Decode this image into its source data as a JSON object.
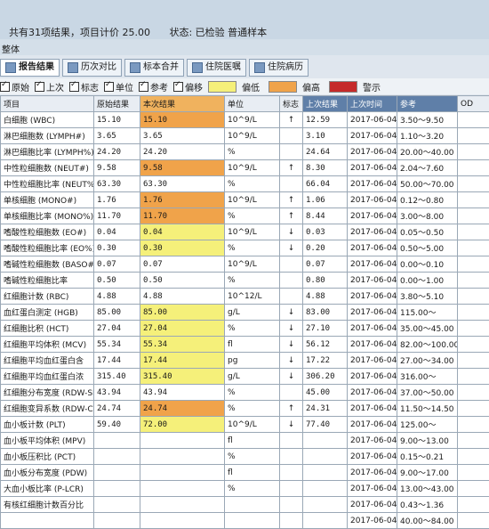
{
  "header": {
    "summary_count": "共有31项结果，项目计价 25.00",
    "summary_status": "状态: 已检验 普通样本",
    "group_label": "整体"
  },
  "tabs": [
    "报告结果",
    "历次对比",
    "标本合并",
    "住院医嘱",
    "住院病历"
  ],
  "filters": {
    "items": [
      "原始",
      "上次",
      "标志",
      "单位",
      "参考",
      "偏移"
    ],
    "legend": [
      {
        "label": "偏低",
        "color": "#f5f07a"
      },
      {
        "label": "偏高",
        "color": "#f0a34a"
      },
      {
        "label": "警示",
        "color": "#c52a2a"
      }
    ]
  },
  "columns": [
    "项目",
    "原始结果",
    "本次结果",
    "单位",
    "标志",
    "上次结果",
    "上次时间",
    "参考",
    "OD"
  ],
  "rows": [
    {
      "name": "白细胞 (WBC)",
      "orig": "15.10",
      "cur": "15.10",
      "unit": "10^9/L",
      "flag": "↑",
      "prev": "12.59",
      "date": "2017-06-04",
      "ref": "3.50～9.50",
      "hl": "o"
    },
    {
      "name": "淋巴细胞数 (LYMPH#)",
      "orig": "3.65",
      "cur": "3.65",
      "unit": "10^9/L",
      "flag": "",
      "prev": "3.10",
      "date": "2017-06-04",
      "ref": "1.10～3.20",
      "hl": ""
    },
    {
      "name": "淋巴细胞比率 (LYMPH%)",
      "orig": "24.20",
      "cur": "24.20",
      "unit": "%",
      "flag": "",
      "prev": "24.64",
      "date": "2017-06-04",
      "ref": "20.00～40.00",
      "hl": ""
    },
    {
      "name": "中性粒细胞数 (NEUT#)",
      "orig": "9.58",
      "cur": "9.58",
      "unit": "10^9/L",
      "flag": "↑",
      "prev": "8.30",
      "date": "2017-06-04",
      "ref": "2.04～7.60",
      "hl": "o"
    },
    {
      "name": "中性粒细胞比率 (NEUT%)",
      "orig": "63.30",
      "cur": "63.30",
      "unit": "%",
      "flag": "",
      "prev": "66.04",
      "date": "2017-06-04",
      "ref": "50.00～70.00",
      "hl": ""
    },
    {
      "name": "单核细胞 (MONO#)",
      "orig": "1.76",
      "cur": "1.76",
      "unit": "10^9/L",
      "flag": "↑",
      "prev": "1.06",
      "date": "2017-06-04",
      "ref": "0.12～0.80",
      "hl": "o"
    },
    {
      "name": "单核细胞比率 (MONO%)",
      "orig": "11.70",
      "cur": "11.70",
      "unit": "%",
      "flag": "↑",
      "prev": "8.44",
      "date": "2017-06-04",
      "ref": "3.00～8.00",
      "hl": "o"
    },
    {
      "name": "嗜酸性粒细胞数 (EO#)",
      "orig": "0.04",
      "cur": "0.04",
      "unit": "10^9/L",
      "flag": "↓",
      "prev": "0.03",
      "date": "2017-06-04",
      "ref": "0.05～0.50",
      "hl": "y"
    },
    {
      "name": "嗜酸性粒细胞比率 (EO%)",
      "orig": "0.30",
      "cur": "0.30",
      "unit": "%",
      "flag": "↓",
      "prev": "0.20",
      "date": "2017-06-04",
      "ref": "0.50～5.00",
      "hl": "y"
    },
    {
      "name": "嗜碱性粒细胞数 (BASO#)",
      "orig": "0.07",
      "cur": "0.07",
      "unit": "10^9/L",
      "flag": "",
      "prev": "0.07",
      "date": "2017-06-04",
      "ref": "0.00～0.10",
      "hl": ""
    },
    {
      "name": "嗜碱性粒细胞比率",
      "orig": "0.50",
      "cur": "0.50",
      "unit": "%",
      "flag": "",
      "prev": "0.80",
      "date": "2017-06-04",
      "ref": "0.00～1.00",
      "hl": ""
    },
    {
      "name": "红细胞计数 (RBC)",
      "orig": "4.88",
      "cur": "4.88",
      "unit": "10^12/L",
      "flag": "",
      "prev": "4.88",
      "date": "2017-06-04",
      "ref": "3.80～5.10",
      "hl": ""
    },
    {
      "name": "血红蛋白测定 (HGB)",
      "orig": "85.00",
      "cur": "85.00",
      "unit": "g/L",
      "flag": "↓",
      "prev": "83.00",
      "date": "2017-06-04",
      "ref": "115.00～",
      "hl": "y"
    },
    {
      "name": "红细胞比积 (HCT)",
      "orig": "27.04",
      "cur": "27.04",
      "unit": "%",
      "flag": "↓",
      "prev": "27.10",
      "date": "2017-06-04",
      "ref": "35.00～45.00",
      "hl": "y"
    },
    {
      "name": "红细胞平均体积 (MCV)",
      "orig": "55.34",
      "cur": "55.34",
      "unit": "fl",
      "flag": "↓",
      "prev": "56.12",
      "date": "2017-06-04",
      "ref": "82.00～100.00",
      "hl": "y"
    },
    {
      "name": "红细胞平均血红蛋白含",
      "orig": "17.44",
      "cur": "17.44",
      "unit": "pg",
      "flag": "↓",
      "prev": "17.22",
      "date": "2017-06-04",
      "ref": "27.00～34.00",
      "hl": "y"
    },
    {
      "name": "红细胞平均血红蛋白浓",
      "orig": "315.40",
      "cur": "315.40",
      "unit": "g/L",
      "flag": "↓",
      "prev": "306.20",
      "date": "2017-06-04",
      "ref": "316.00～",
      "hl": "y"
    },
    {
      "name": "红细胞分布宽度 (RDW-SD)",
      "orig": "43.94",
      "cur": "43.94",
      "unit": "%",
      "flag": "",
      "prev": "45.00",
      "date": "2017-06-04",
      "ref": "37.00～50.00",
      "hl": ""
    },
    {
      "name": "红细胞变异系数 (RDW-CV)",
      "orig": "24.74",
      "cur": "24.74",
      "unit": "%",
      "flag": "↑",
      "prev": "24.31",
      "date": "2017-06-04",
      "ref": "11.50～14.50",
      "hl": "o"
    },
    {
      "name": "血小板计数 (PLT)",
      "orig": "59.40",
      "cur": "72.00",
      "unit": "10^9/L",
      "flag": "↓",
      "prev": "77.40",
      "date": "2017-06-04",
      "ref": "125.00～",
      "hl": "y"
    },
    {
      "name": "血小板平均体积 (MPV)",
      "orig": "",
      "cur": "",
      "unit": "fl",
      "flag": "",
      "prev": "",
      "date": "2017-06-04",
      "ref": "9.00～13.00",
      "hl": ""
    },
    {
      "name": "血小板压积比 (PCT)",
      "orig": "",
      "cur": "",
      "unit": "%",
      "flag": "",
      "prev": "",
      "date": "2017-06-04",
      "ref": "0.15～0.21",
      "hl": ""
    },
    {
      "name": "血小板分布宽度 (PDW)",
      "orig": "",
      "cur": "",
      "unit": "fl",
      "flag": "",
      "prev": "",
      "date": "2017-06-04",
      "ref": "9.00～17.00",
      "hl": ""
    },
    {
      "name": "大血小板比率 (P-LCR)",
      "orig": "",
      "cur": "",
      "unit": "%",
      "flag": "",
      "prev": "",
      "date": "2017-06-04",
      "ref": "13.00～43.00",
      "hl": ""
    },
    {
      "name": "有核红细胞计数百分比",
      "orig": "",
      "cur": "",
      "unit": "",
      "flag": "",
      "prev": "",
      "date": "2017-06-04",
      "ref": "0.43～1.36",
      "hl": ""
    },
    {
      "name": "",
      "orig": "",
      "cur": "",
      "unit": "",
      "flag": "",
      "prev": "",
      "date": "2017-06-04",
      "ref": "40.00～84.00",
      "hl": ""
    }
  ]
}
